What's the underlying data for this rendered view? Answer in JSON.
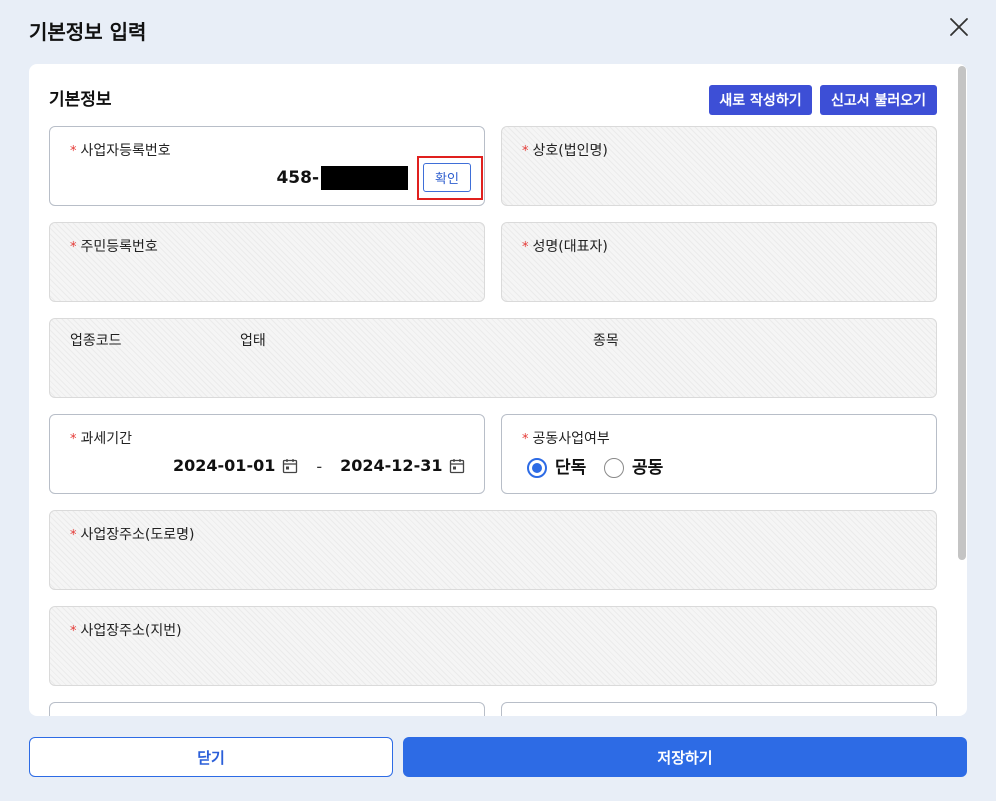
{
  "dialog": {
    "title": "기본정보 입력"
  },
  "section": {
    "title": "기본정보"
  },
  "actions": {
    "new_label": "새로 작성하기",
    "load_label": "신고서 불러오기"
  },
  "required_mark": "*",
  "fields": {
    "biz_no": {
      "label": "사업자등록번호",
      "value": "458-",
      "confirm_label": "확인"
    },
    "company": {
      "label": "상호(법인명)"
    },
    "resident_no": {
      "label": "주민등록번호"
    },
    "rep_name": {
      "label": "성명(대표자)"
    },
    "industry": {
      "code_label": "업종코드",
      "type_label": "업태",
      "item_label": "종목"
    },
    "tax_period": {
      "label": "과세기간",
      "start": "2024-01-01",
      "separator": "-",
      "end": "2024-12-31"
    },
    "joint_business": {
      "label": "공동사업여부",
      "options": [
        {
          "label": "단독",
          "selected": true
        },
        {
          "label": "공동",
          "selected": false
        }
      ]
    },
    "address_road": {
      "label": "사업장주소(도로명)"
    },
    "address_lot": {
      "label": "사업장주소(지번)"
    }
  },
  "footer": {
    "close_label": "닫기",
    "save_label": "저장하기"
  },
  "icons": {
    "close": "close-icon",
    "calendar": "calendar-icon"
  },
  "colors": {
    "background": "#e8eef7",
    "primary": "#3d4fd6",
    "accent": "#2d6be5",
    "required": "#e53935",
    "highlight": "#e0201e"
  }
}
